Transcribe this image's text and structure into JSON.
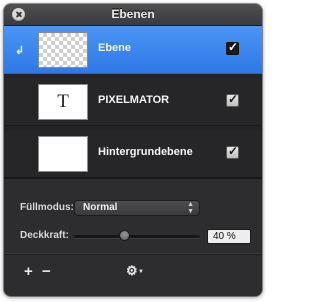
{
  "window": {
    "title": "Ebenen"
  },
  "layers": [
    {
      "name": "Ebene",
      "selected": true,
      "visible": true,
      "thumbnail": "transparent",
      "linked_icon": "↲"
    },
    {
      "name": "PIXELMATOR",
      "selected": false,
      "visible": true,
      "thumbnail": "text",
      "thumb_glyph": "T"
    },
    {
      "name": "Hintergrundebene",
      "selected": false,
      "visible": true,
      "thumbnail": "white"
    }
  ],
  "properties": {
    "blend_label": "Füllmodus:",
    "blend_value": "Normal",
    "opacity_label": "Deckkraft:",
    "opacity_value": "40 %",
    "opacity_fraction": 0.4
  },
  "footer": {
    "add_icon": "+",
    "remove_icon": "−",
    "gear_icon": "⚙"
  },
  "colors": {
    "selection": "#3f86ef",
    "panel": "#2b2b2d"
  },
  "check_glyph": "✓",
  "select_arrows": "▲▼"
}
